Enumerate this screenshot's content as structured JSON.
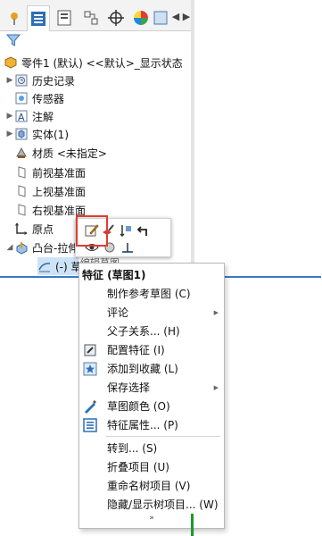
{
  "tree": {
    "part": "零件1 (默认) <<默认>_显示状态",
    "history": "历史记录",
    "sensors": "传感器",
    "annotations": "注解",
    "solid_bodies": "实体(1)",
    "material": "材质 <未指定>",
    "front_plane": "前视基准面",
    "top_plane": "上视基准面",
    "right_plane": "右视基准面",
    "origin": "原点",
    "boss_extrude": "凸台-拉伸",
    "sketch": "(-) 草"
  },
  "tooltip": "编辑草图",
  "menu": {
    "header": "特征 (草图1)",
    "items": [
      {
        "label": "制作参考草图 (C)",
        "icon": "",
        "submenu": false
      },
      {
        "label": "评论",
        "icon": "",
        "submenu": true
      },
      {
        "label": "父子关系... (H)",
        "icon": "",
        "submenu": false
      },
      {
        "label": "配置特征 (I)",
        "icon": "configure-icon",
        "submenu": false
      },
      {
        "label": "添加到收藏 (L)",
        "icon": "favorite-icon",
        "submenu": false
      },
      {
        "label": "保存选择",
        "icon": "",
        "submenu": true
      },
      {
        "label": "草图颜色 (O)",
        "icon": "sketch-color-icon",
        "submenu": false
      },
      {
        "label": "特征属性... (P)",
        "icon": "properties-icon",
        "submenu": false
      },
      {
        "label": "转到... (S)",
        "icon": "",
        "submenu": false
      },
      {
        "label": "折叠项目 (U)",
        "icon": "",
        "submenu": false
      },
      {
        "label": "重命名树项目 (V)",
        "icon": "",
        "submenu": false
      },
      {
        "label": "隐藏/显示树项目... (W)",
        "icon": "",
        "submenu": false
      }
    ],
    "more": "»"
  },
  "colors": {
    "selection": "#3a78c8",
    "highlight_box": "#e23b2e",
    "accent_green": "#1c9a2a"
  }
}
